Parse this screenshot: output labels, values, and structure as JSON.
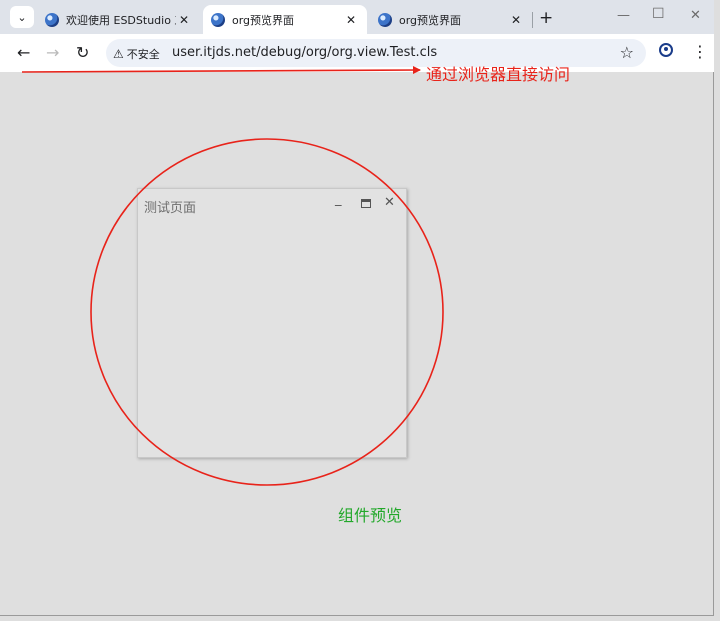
{
  "tabs": [
    {
      "title": "欢迎使用 ESDStudio 工",
      "close": "✕",
      "active": false
    },
    {
      "title": "org预览界面",
      "close": "✕",
      "active": true
    },
    {
      "title": "org预览界面",
      "close": "✕",
      "active": false
    }
  ],
  "tab_search_icon": "chevron-down-icon",
  "new_tab_icon": "+",
  "address_bar": {
    "security_label": "不安全",
    "url": "user.itjds.net/debug/org/org.view.Test.cls"
  },
  "annotation": {
    "label": "通过浏览器直接访问",
    "color": "#e8231a"
  },
  "test_window": {
    "title": "测试页面"
  },
  "preview_label": {
    "text": "组件预览",
    "color": "#22a82a"
  }
}
